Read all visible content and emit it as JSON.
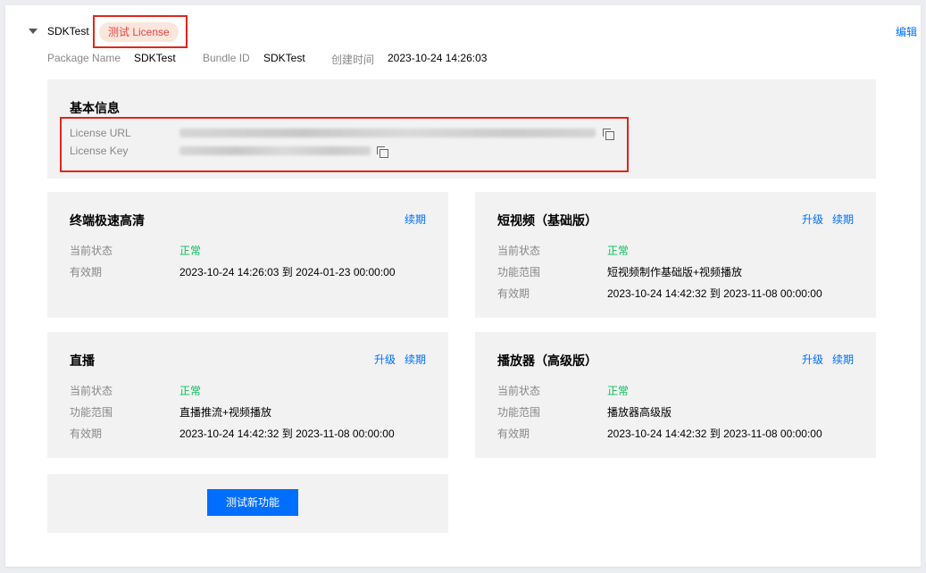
{
  "header": {
    "app_name": "SDKTest",
    "tag": "测试 License",
    "edit": "编辑",
    "meta": [
      {
        "label": "Package Name",
        "value": "SDKTest"
      },
      {
        "label": "Bundle ID",
        "value": "SDKTest"
      },
      {
        "label": "创建时间",
        "value": "2023-10-24 14:26:03"
      }
    ]
  },
  "basic": {
    "title": "基本信息",
    "url_label": "License URL",
    "key_label": "License Key"
  },
  "panels": {
    "terminal": {
      "title": "终端极速高清",
      "renew": "续期",
      "status_label": "当前状态",
      "status": "正常",
      "validity_label": "有效期",
      "validity": "2023-10-24 14:26:03 到 2024-01-23 00:00:00"
    },
    "shortvideo": {
      "title": "短视频（基础版）",
      "upgrade": "升级",
      "renew": "续期",
      "status_label": "当前状态",
      "status": "正常",
      "scope_label": "功能范围",
      "scope": "短视频制作基础版+视频播放",
      "validity_label": "有效期",
      "validity": "2023-10-24 14:42:32 到 2023-11-08 00:00:00"
    },
    "live": {
      "title": "直播",
      "upgrade": "升级",
      "renew": "续期",
      "status_label": "当前状态",
      "status": "正常",
      "scope_label": "功能范围",
      "scope": "直播推流+视频播放",
      "validity_label": "有效期",
      "validity": "2023-10-24 14:42:32 到 2023-11-08 00:00:00"
    },
    "player": {
      "title": "播放器（高级版）",
      "upgrade": "升级",
      "renew": "续期",
      "status_label": "当前状态",
      "status": "正常",
      "scope_label": "功能范围",
      "scope": "播放器高级版",
      "validity_label": "有效期",
      "validity": "2023-10-24 14:42:32 到 2023-11-08 00:00:00"
    }
  },
  "test_button": "测试新功能",
  "colors": {
    "accent": "#006eff",
    "ok": "#0abf5b",
    "highlight": "#e1251b",
    "tag_bg": "#fbe6dc"
  },
  "icons": [
    "caret-down-icon",
    "copy-icon"
  ]
}
